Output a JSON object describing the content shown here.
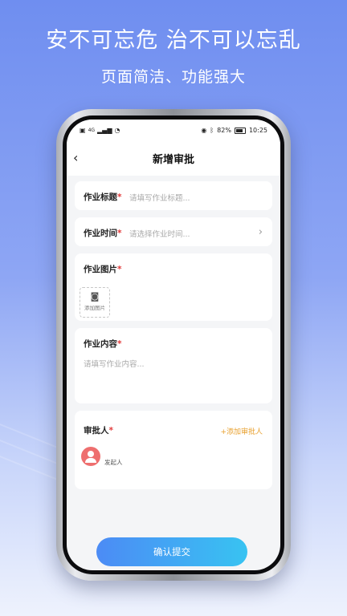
{
  "promo": {
    "headline": "安不可忘危  治不可以忘乱",
    "subline": "页面简洁、功能强大"
  },
  "status_bar": {
    "signal_text": "4G",
    "battery": "82%",
    "time": "10:25"
  },
  "nav": {
    "back_glyph": "‹",
    "title": "新增审批"
  },
  "form": {
    "title_label": "作业标题",
    "title_placeholder": "请填写作业标题...",
    "time_label": "作业时间",
    "time_placeholder": "请选择作业时间...",
    "image_label": "作业图片",
    "add_image_text": "添加图片",
    "content_label": "作业内容",
    "content_placeholder": "请填写作业内容...",
    "approver_label": "审批人",
    "add_approver": "+添加审批人",
    "initiator_label": "发起人",
    "required_mark": "*"
  },
  "submit_label": "确认提交",
  "colors": {
    "accent_start": "#4c8bf5",
    "accent_end": "#38c3f2",
    "required": "#e23a3a",
    "add_link": "#e8a02e",
    "avatar": "#ee6f6f"
  }
}
